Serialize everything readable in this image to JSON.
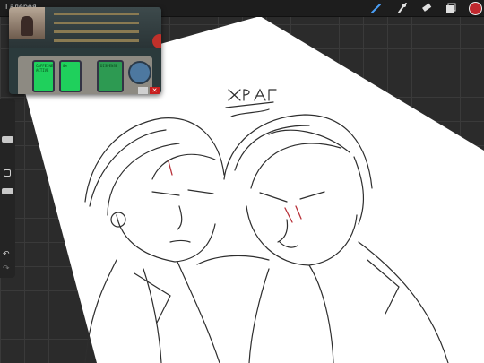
{
  "topbar": {
    "gallery_label": "Галерея",
    "tools": [
      "brush-icon",
      "smudge-icon",
      "eraser-icon",
      "layers-icon"
    ],
    "color": "#c0282e"
  },
  "canvas": {
    "sketch_text": "ХРАГ"
  },
  "pip_video": {
    "terminal_text": [
      "CAFFEINE",
      "ACTIVE",
      "0%",
      "DISPENSE"
    ]
  },
  "sidebar": {
    "undo_symbol": "↶",
    "redo_symbol": "↷"
  }
}
